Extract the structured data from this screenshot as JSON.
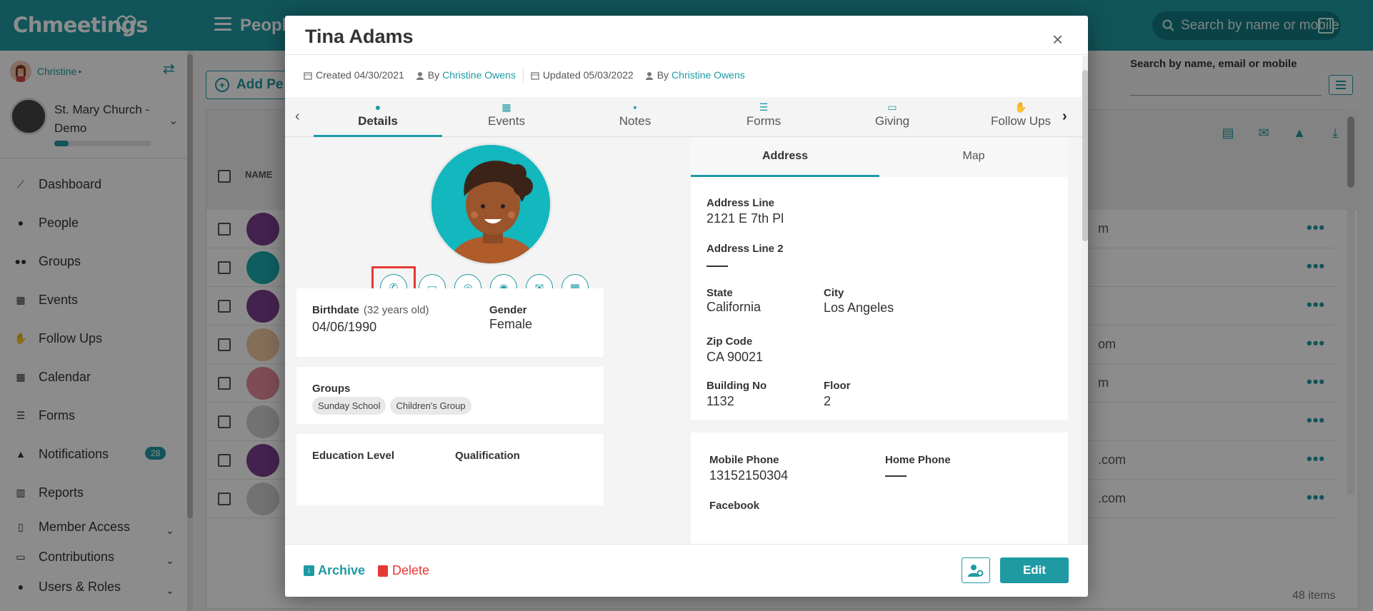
{
  "app": {
    "brand": "Chmeetings",
    "page_title": "People",
    "search_placeholder": "Search by name or mobile"
  },
  "sidebar": {
    "user_name": "Christine",
    "church_name": "St. Mary Church - Demo",
    "church_progress": 0.15,
    "items": [
      {
        "label": "Dashboard",
        "icon": "chart-line-icon"
      },
      {
        "label": "People",
        "icon": "person-icon"
      },
      {
        "label": "Groups",
        "icon": "users-icon"
      },
      {
        "label": "Events",
        "icon": "calendar-icon"
      },
      {
        "label": "Follow Ups",
        "icon": "handshake-icon"
      },
      {
        "label": "Calendar",
        "icon": "calendar-grid-icon"
      },
      {
        "label": "Forms",
        "icon": "list-icon"
      },
      {
        "label": "Notifications",
        "icon": "bell-icon",
        "badge": "28"
      },
      {
        "label": "Reports",
        "icon": "bar-chart-icon"
      },
      {
        "label": "Member Access",
        "icon": "mobile-icon",
        "expandable": true
      },
      {
        "label": "Contributions",
        "icon": "money-icon",
        "expandable": true
      },
      {
        "label": "Users & Roles",
        "icon": "users-cog-icon",
        "expandable": true
      }
    ]
  },
  "main": {
    "add_button": "Add Pe",
    "right_search_label": "Search by name, email or mobile",
    "table_header_name": "NAME",
    "rows": [
      {
        "email_tail": "m"
      },
      {
        "email_tail": ""
      },
      {
        "email_tail": ""
      },
      {
        "email_tail": "om"
      },
      {
        "email_tail": "m"
      },
      {
        "email_tail": ""
      },
      {
        "email_tail": ".com"
      },
      {
        "email_tail": ".com"
      }
    ],
    "items_count": "48 items"
  },
  "modal": {
    "title": "Tina Adams",
    "created_label": "Created 04/30/2021",
    "by_label_1": "By",
    "by_user_1": "Christine Owens",
    "updated_label": "Updated 05/03/2022",
    "by_label_2": "By",
    "by_user_2": "Christine Owens",
    "tabs": [
      {
        "label": "Details",
        "icon": "person-icon",
        "active": true
      },
      {
        "label": "Events",
        "icon": "calendar-check-icon"
      },
      {
        "label": "Notes",
        "icon": "note-icon"
      },
      {
        "label": "Forms",
        "icon": "list-icon"
      },
      {
        "label": "Giving",
        "icon": "money-icon"
      },
      {
        "label": "Follow Ups",
        "icon": "handshake-icon"
      }
    ],
    "contact_icons": [
      "phone-icon",
      "message-icon",
      "whatsapp-icon",
      "viber-icon",
      "envelope-icon",
      "qrcode-icon"
    ],
    "personal": {
      "birthdate_label": "Birthdate",
      "birthdate_age": "(32 years old)",
      "birthdate_value": "04/06/1990",
      "gender_label": "Gender",
      "gender_value": "Female"
    },
    "groups": {
      "label": "Groups",
      "chips": [
        "Sunday School",
        "Children's Group"
      ]
    },
    "education": {
      "education_label": "Education Level",
      "qualification_label": "Qualification"
    },
    "address_tabs": [
      "Address",
      "Map"
    ],
    "address": {
      "line1_label": "Address Line",
      "line1_value": "2121 E 7th Pl",
      "line2_label": "Address Line 2",
      "state_label": "State",
      "state_value": "California",
      "city_label": "City",
      "city_value": "Los Angeles",
      "zip_label": "Zip Code",
      "zip_value": "CA 90021",
      "building_label": "Building No",
      "building_value": "1132",
      "floor_label": "Floor",
      "floor_value": "2"
    },
    "contact": {
      "mobile_label": "Mobile Phone",
      "mobile_value": "13152150304",
      "home_label": "Home Phone",
      "facebook_label": "Facebook"
    },
    "footer": {
      "archive": "Archive",
      "delete": "Delete",
      "edit": "Edit"
    }
  },
  "colors": {
    "brand": "#1f9aa3",
    "danger": "#e53935",
    "highlight_border": "#e53935"
  }
}
